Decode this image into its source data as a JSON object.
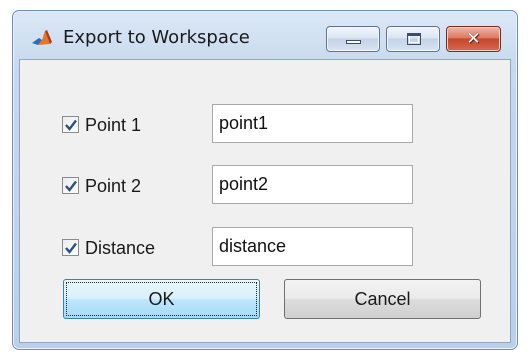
{
  "window": {
    "title": "Export to Workspace",
    "app_icon": "matlab-logo-icon",
    "controls": {
      "minimize_icon": "minimize-icon",
      "maximize_icon": "maximize-icon",
      "close_icon": "close-icon",
      "close_glyph": "✕"
    }
  },
  "rows": [
    {
      "checked": true,
      "label": "Point 1",
      "value": "point1"
    },
    {
      "checked": true,
      "label": "Point 2",
      "value": "point2"
    },
    {
      "checked": true,
      "label": "Distance",
      "value": "distance"
    }
  ],
  "buttons": {
    "ok_label": "OK",
    "cancel_label": "Cancel"
  },
  "colors": {
    "titlebar": "#c6d8ee",
    "close_button": "#c5472c",
    "dialog_background": "#f0f0f0",
    "checkmark": "#2b4f7f",
    "default_button_border": "#3c7fb1"
  }
}
